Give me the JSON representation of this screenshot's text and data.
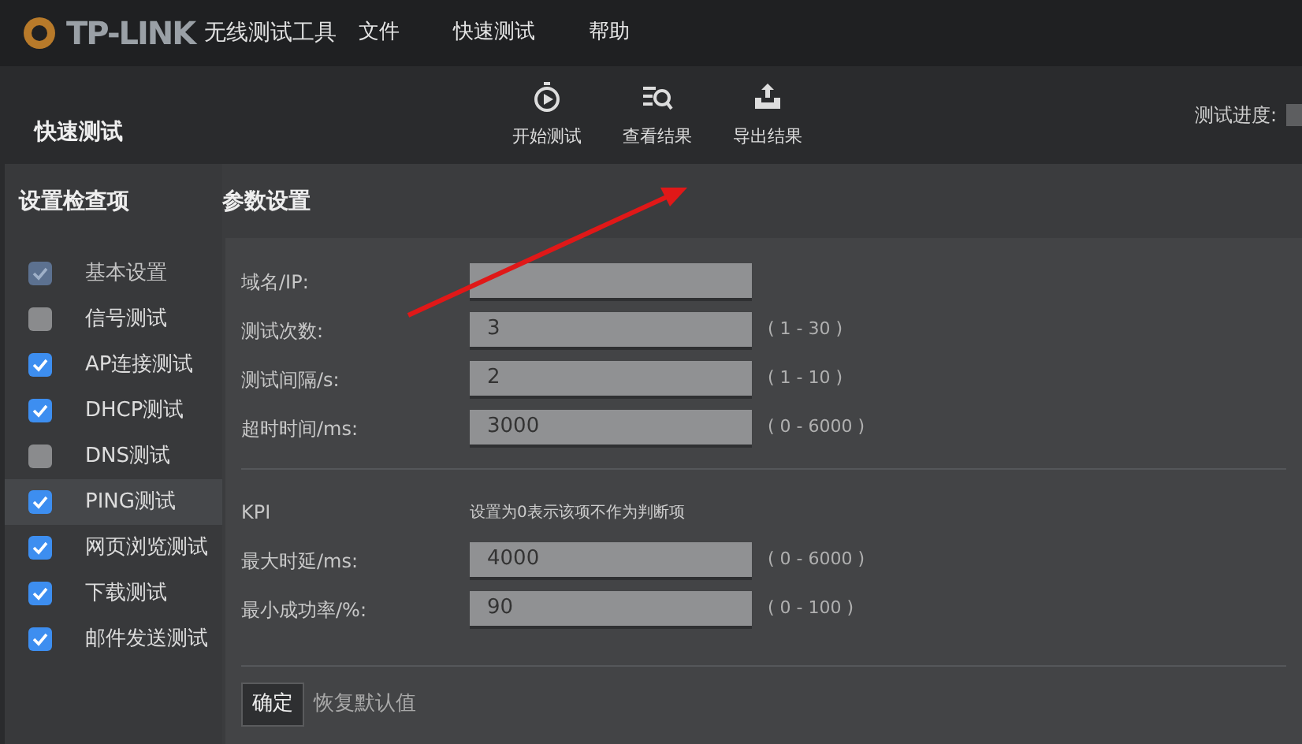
{
  "title_bar": {
    "brand": "TP-LINK",
    "app_name": "无线测试工具",
    "menu": [
      {
        "label": "文件"
      },
      {
        "label": "快速测试"
      },
      {
        "label": "帮助"
      }
    ]
  },
  "toolbar": {
    "title": "快速测试",
    "actions": [
      {
        "kind": "start",
        "label": "开始测试"
      },
      {
        "kind": "view",
        "label": "查看结果"
      },
      {
        "kind": "export",
        "label": "导出结果"
      }
    ],
    "progress_label": "测试进度:"
  },
  "sidebar": {
    "title": "设置检查项",
    "items": [
      {
        "label": "基本设置",
        "checked": true,
        "disabled": true,
        "selected": false
      },
      {
        "label": "信号测试",
        "checked": false,
        "disabled": false,
        "selected": false
      },
      {
        "label": "AP连接测试",
        "checked": true,
        "disabled": false,
        "selected": false
      },
      {
        "label": "DHCP测试",
        "checked": true,
        "disabled": false,
        "selected": false
      },
      {
        "label": "DNS测试",
        "checked": false,
        "disabled": false,
        "selected": false
      },
      {
        "label": "PING测试",
        "checked": true,
        "disabled": false,
        "selected": true
      },
      {
        "label": "网页浏览测试",
        "checked": true,
        "disabled": false,
        "selected": false
      },
      {
        "label": "下载测试",
        "checked": true,
        "disabled": false,
        "selected": false
      },
      {
        "label": "邮件发送测试",
        "checked": true,
        "disabled": false,
        "selected": false
      }
    ]
  },
  "settings": {
    "title": "参数设置",
    "fields": [
      {
        "label": "域名/IP:"
      },
      {
        "label": "测试次数:",
        "value": "3",
        "range": "( 1 - 30 )"
      },
      {
        "label": "测试间隔/s:",
        "value": "2",
        "range": "( 1 - 10 )"
      },
      {
        "label": "超时时间/ms:",
        "value": "3000",
        "range": "( 0 - 6000 )"
      }
    ],
    "kpi": {
      "title": "KPI",
      "note": "设置为0表示该项不作为判断项",
      "fields": [
        {
          "label": "最大时延/ms:",
          "value": "4000",
          "range": "( 0 - 6000 )"
        },
        {
          "label": "最小成功率/%:",
          "value": "90",
          "range": "( 0 - 100 )"
        }
      ]
    },
    "confirm_button": "确定",
    "reset_link": "恢复默认值"
  }
}
